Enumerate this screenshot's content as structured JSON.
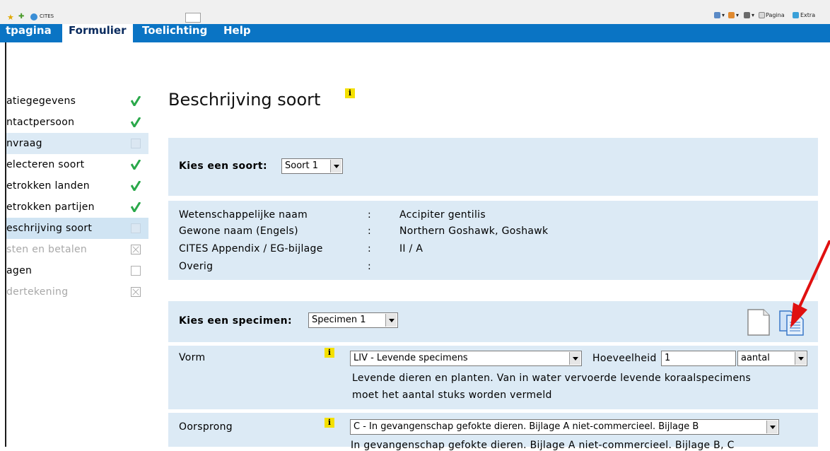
{
  "browser": {
    "tab_title": "CITES",
    "commands": [
      "Pagina",
      "Extra"
    ]
  },
  "nav": {
    "items": [
      "tpagina",
      "Formulier",
      "Toelichting",
      "Help"
    ],
    "active": "Formulier"
  },
  "sidebar": {
    "items": [
      {
        "label": "atiegegevens",
        "status": "done"
      },
      {
        "label": "ntactpersoon",
        "status": "done"
      },
      {
        "label": "nvraag",
        "status": "empty"
      },
      {
        "label": "electeren soort",
        "status": "done"
      },
      {
        "label": "etrokken landen",
        "status": "done"
      },
      {
        "label": "etrokken partijen",
        "status": "done"
      },
      {
        "label": "eschrijving soort",
        "status": "current"
      },
      {
        "label": "sten en betalen",
        "status": "unavailable"
      },
      {
        "label": "agen",
        "status": "empty"
      },
      {
        "label": "dertekening",
        "status": "unavailable"
      }
    ]
  },
  "main": {
    "title": "Beschrijving soort",
    "info_glyph": "i",
    "soort": {
      "label": "Kies een soort:",
      "selected": "Soort 1"
    },
    "details": [
      {
        "label": "Wetenschappelijke naam",
        "sep": ":",
        "value": "Accipiter gentilis"
      },
      {
        "label": "Gewone naam (Engels)",
        "sep": ":",
        "value": "Northern Goshawk, Goshawk"
      },
      {
        "label": "CITES Appendix / EG-bijlage",
        "sep": ":",
        "value": "II / A"
      },
      {
        "label": "Overig",
        "sep": ":",
        "value": ""
      }
    ],
    "specimen": {
      "label": "Kies een specimen:",
      "selected": "Specimen 1"
    },
    "vorm": {
      "label": "Vorm",
      "selected": "LIV - Levende specimens",
      "quantity_label": "Hoeveelheid",
      "quantity_value": "1",
      "unit": "aantal",
      "help_line1": "Levende dieren en planten. Van in water vervoerde levende koraalspecimens",
      "help_line2": "moet het aantal stuks worden vermeld"
    },
    "oorsprong": {
      "label": "Oorsprong",
      "selected": "C - In gevangenschap gefokte dieren. Bijlage A niet-commercieel. Bijlage B",
      "help_line1": "In gevangenschap gefokte dieren. Bijlage A niet-commercieel. Bijlage B, C"
    }
  },
  "colors": {
    "nav_blue": "#0a74c4",
    "panel_blue": "#dceaf5",
    "check_green": "#2aa84a",
    "arrow_red": "#e01010",
    "info_yellow": "#f4e000"
  }
}
